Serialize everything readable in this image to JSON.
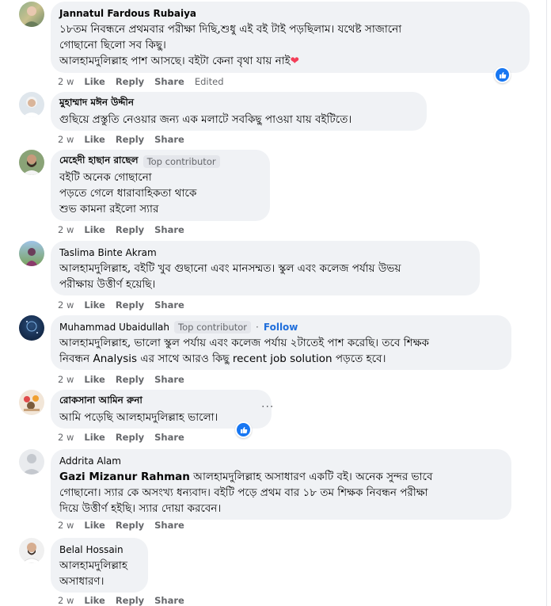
{
  "actions": {
    "like": "Like",
    "reply": "Reply",
    "share": "Share",
    "edited": "Edited"
  },
  "comments": [
    {
      "name": "Jannatul Fardous Rubaiya",
      "time": "2 w",
      "edited": true,
      "line1": "১৮তম নিবন্ধনে প্রথমবার পরীক্ষা দিছি,শুধু এই বই টাই পড়ছিলাম। যথেষ্ট সাজানো",
      "line2": "গোছানো ছিলো সব কিছু।",
      "line3": "আলহামদুলিল্লাহ পাশ আসছে। বইটা কেনা বৃথা যায় নাই",
      "heart": "❤"
    },
    {
      "name": "মুহাম্মাদ মঈন উদ্দীন",
      "time": "2 w",
      "text": "গুছিয়ে প্রস্তুতি নেওয়ার জন্য এক মলাটে সবকিছু পাওয়া যায় বইটিতে।"
    },
    {
      "name": "মেহেদী হাছান রাছেল",
      "badge": "Top contributor",
      "time": "2 w",
      "text": "বইটি অনেক গোছানো\nপড়তে গেলে ধারাবাহিকতা থাকে\nশুভ কামনা রইলো স্যার"
    },
    {
      "name": "Taslima Binte Akram",
      "time": "2 w",
      "text": "আলহামদুলিল্লাহ, বইটি খুব গুছানো এবং মানসম্মত। স্কুল এবং কলেজ পর্যায় উভয়\nপরীক্ষায় উত্তীর্ণ হয়েছি।"
    },
    {
      "name": "Muhammad Ubaidullah",
      "badge": "Top contributor",
      "dot": "·",
      "follow": "Follow",
      "time": "2 w",
      "text": "আলহামদুলিল্লাহ, ভালো স্কুল পর্যায় এবং কলেজ পর্যায় ২টাতেই পাশ করেছি। তবে শিক্ষক\nনিবন্ধন Analysis এর সাথে আরও কিছু recent job solution পড়তে হবে।"
    },
    {
      "name": "রোকসানা আমিন রুনা",
      "time": "2 w",
      "text": "আমি পড়েছি আলহামদুলিল্লাহ ভালো।",
      "more": "···"
    },
    {
      "name": "Addrita Alam",
      "time": "2 w",
      "tag": "Gazi Mizanur Rahman",
      "line1": " আলহামদুলিল্লাহ অসাধারণ একটি বই। অনেক সুন্দর ভাবে",
      "line2": "গোছানো। স্যার কে অসংখ্য ধন্যবাদ। বইটি পড়ে প্রথম বার ১৮ তম শিক্ষক নিবন্ধন পরীক্ষা",
      "line3": "দিয়ে উত্তীর্ণ হইছি। স্যার দোয়া করবেন।"
    },
    {
      "name": "Belal Hossain",
      "time": "2 w",
      "text": "আলহামদুলিল্লাহ\nঅসাধারণ।"
    }
  ],
  "colors": {
    "bubble": "#f0f2f5",
    "link": "#216fdb",
    "like_blue": "#1877f2",
    "muted": "#65676b"
  }
}
